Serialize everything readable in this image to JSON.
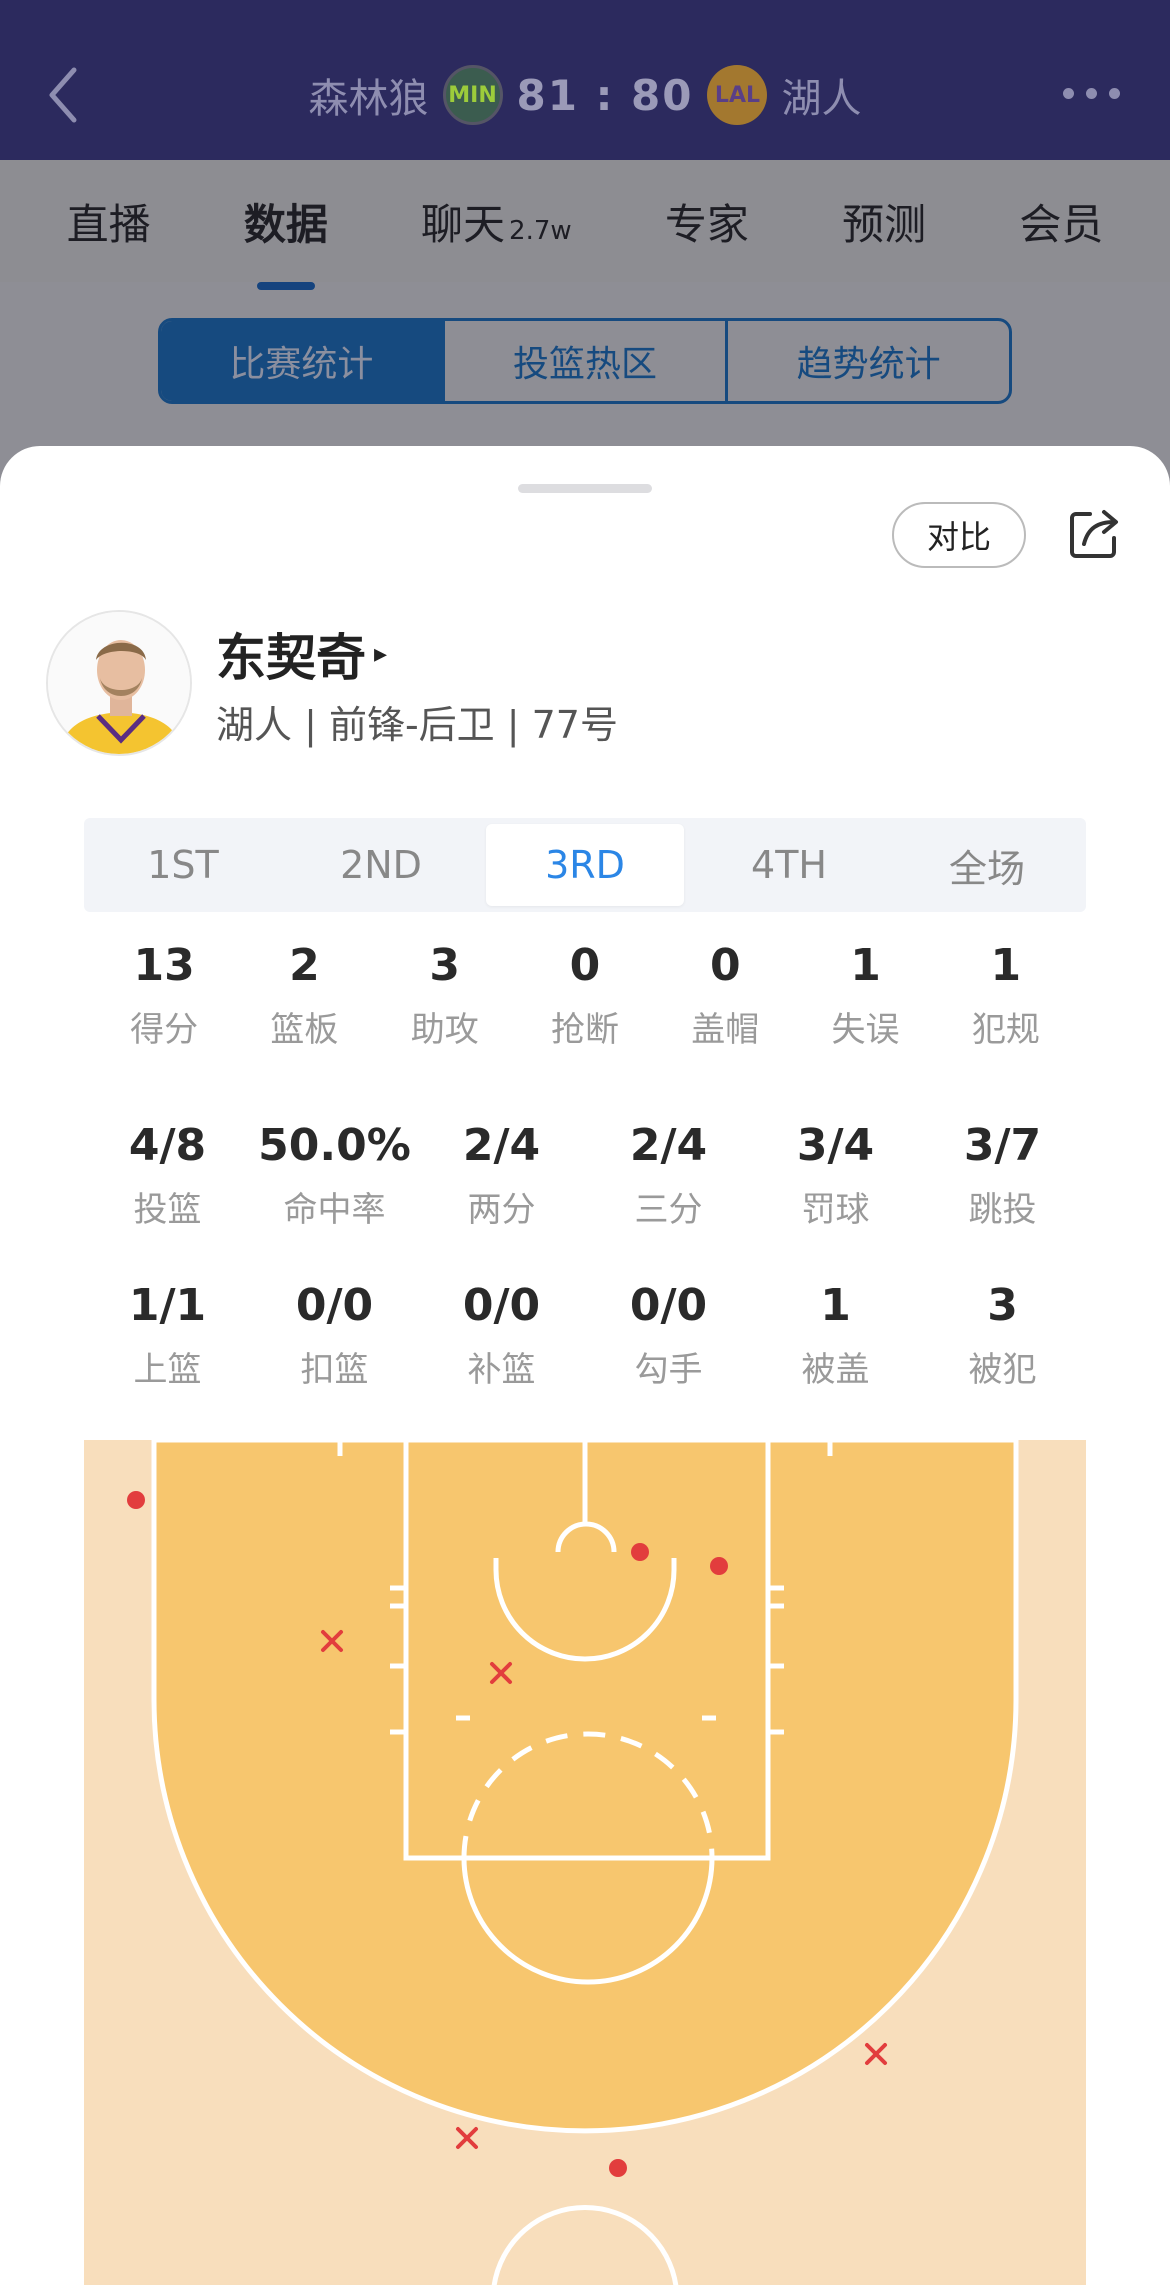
{
  "header": {
    "home_team": "森林狼",
    "home_abbr": "MIN",
    "score": "81 : 80",
    "away_abbr": "LAL",
    "away_team": "湖人"
  },
  "nav": {
    "tabs": [
      {
        "label": "直播",
        "sub": ""
      },
      {
        "label": "数据",
        "sub": ""
      },
      {
        "label": "聊天",
        "sub": "2.7w"
      },
      {
        "label": "专家",
        "sub": ""
      },
      {
        "label": "预测",
        "sub": ""
      },
      {
        "label": "会员",
        "sub": ""
      }
    ],
    "active": "数据"
  },
  "segment": {
    "items": [
      "比赛统计",
      "投篮热区",
      "趋势统计"
    ],
    "active": "比赛统计"
  },
  "sheet": {
    "compare_label": "对比",
    "player": {
      "name": "东契奇",
      "meta": "湖人 | 前锋-后卫 | 77号"
    },
    "periods": [
      "1ST",
      "2ND",
      "3RD",
      "4TH",
      "全场"
    ],
    "active_period": "3RD",
    "basic_stats": [
      {
        "value": "13",
        "label": "得分"
      },
      {
        "value": "2",
        "label": "篮板"
      },
      {
        "value": "3",
        "label": "助攻"
      },
      {
        "value": "0",
        "label": "抢断"
      },
      {
        "value": "0",
        "label": "盖帽"
      },
      {
        "value": "1",
        "label": "失误"
      },
      {
        "value": "1",
        "label": "犯规"
      }
    ],
    "shooting_stats": [
      {
        "value": "4/8",
        "label": "投篮"
      },
      {
        "value": "50.0%",
        "label": "命中率"
      },
      {
        "value": "2/4",
        "label": "两分"
      },
      {
        "value": "2/4",
        "label": "三分"
      },
      {
        "value": "3/4",
        "label": "罚球"
      },
      {
        "value": "3/7",
        "label": "跳投"
      }
    ],
    "misc_stats": [
      {
        "value": "1/1",
        "label": "上篮"
      },
      {
        "value": "0/0",
        "label": "扣篮"
      },
      {
        "value": "0/0",
        "label": "补篮"
      },
      {
        "value": "0/0",
        "label": "勾手"
      },
      {
        "value": "1",
        "label": "被盖"
      },
      {
        "value": "3",
        "label": "被犯"
      }
    ],
    "shot_chart": {
      "made_count": 4,
      "missed_count": 4,
      "colors": {
        "made": "#e23d3d",
        "missed": "#e23d3d",
        "court": "#f7c66e",
        "court_outer": "#f8debc"
      }
    }
  }
}
